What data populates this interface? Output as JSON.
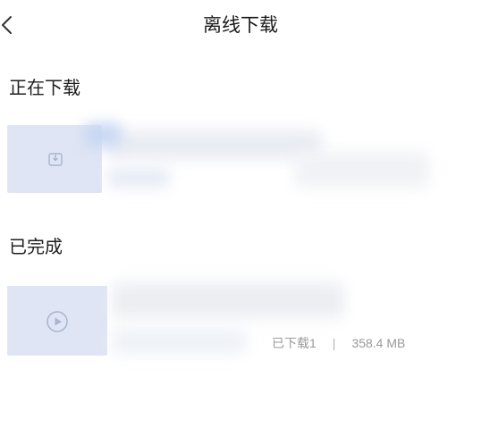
{
  "header": {
    "title": "离线下载",
    "back_icon": "chevron-left-icon"
  },
  "sections": {
    "downloading": {
      "title": "正在下载",
      "item": {
        "icon": "download-box-icon"
      }
    },
    "completed": {
      "title": "已完成",
      "item": {
        "icon": "play-circle-icon",
        "count_label": "已下载1",
        "separator": "|",
        "size": "358.4 MB"
      }
    }
  },
  "colors": {
    "thumb_bg": "#dfe5f4",
    "icon": "#a8b4d0",
    "meta_text": "#9a9a9a"
  }
}
